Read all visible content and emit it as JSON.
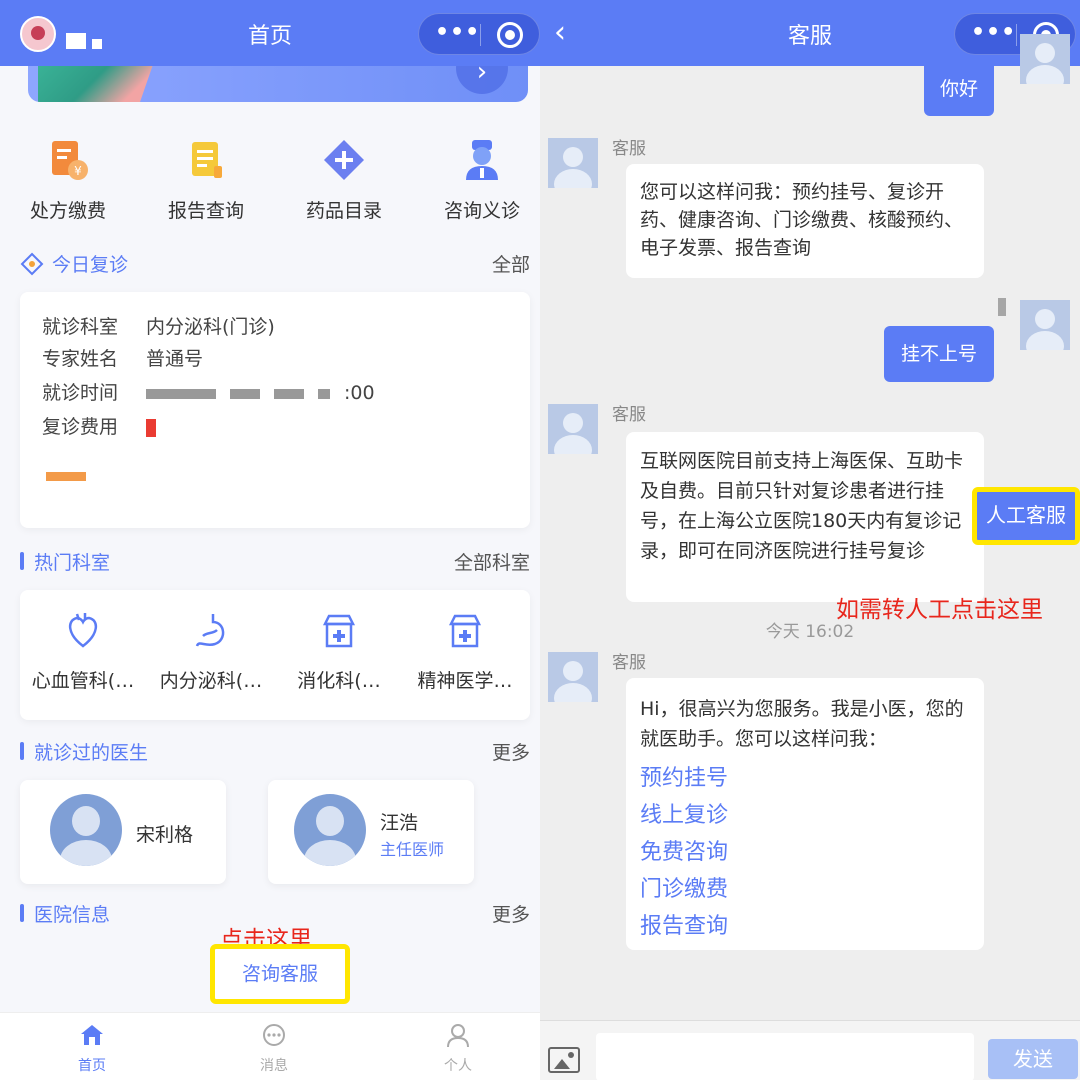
{
  "left": {
    "title": "首页",
    "quick_actions": [
      {
        "label": "处方缴费",
        "icon": "receipt-icon"
      },
      {
        "label": "报告查询",
        "icon": "report-icon"
      },
      {
        "label": "药品目录",
        "icon": "medicine-icon"
      },
      {
        "label": "咨询义诊",
        "icon": "doctor-icon"
      }
    ],
    "today_followup": {
      "title": "今日复诊",
      "more": "全部",
      "fields": [
        {
          "key": "就诊科室",
          "value": "内分泌科(门诊)"
        },
        {
          "key": "专家姓名",
          "value": "普通号"
        },
        {
          "key": "就诊时间",
          "value": ":00"
        },
        {
          "key": "复诊费用",
          "value": ""
        }
      ]
    },
    "hot_depts": {
      "title": "热门科室",
      "more": "全部科室",
      "items": [
        {
          "label": "心血管科(…",
          "icon": "heart-icon"
        },
        {
          "label": "内分泌科(…",
          "icon": "stomach-icon"
        },
        {
          "label": "消化科(…",
          "icon": "clinic-icon"
        },
        {
          "label": "精神医学…",
          "icon": "clinic-icon"
        }
      ]
    },
    "visited_doctors": {
      "title": "就诊过的医生",
      "more": "更多",
      "items": [
        {
          "name": "宋利格",
          "role": ""
        },
        {
          "name": "汪浩",
          "role": "主任医师"
        }
      ]
    },
    "hospital_info": {
      "title": "医院信息",
      "more": "更多"
    },
    "consult_button": "咨询客服",
    "annotation": "点击这里",
    "tabs": [
      {
        "label": "首页",
        "icon": "home-icon",
        "active": true
      },
      {
        "label": "消息",
        "icon": "message-icon",
        "active": false
      },
      {
        "label": "个人",
        "icon": "person-icon",
        "active": false
      }
    ]
  },
  "right": {
    "title": "客服",
    "messages": [
      {
        "from": "me",
        "text": "你好"
      },
      {
        "from": "bot",
        "sender": "客服",
        "text": "您可以这样问我：预约挂号、复诊开药、健康咨询、门诊缴费、核酸预约、电子发票、报告查询"
      },
      {
        "from": "me",
        "text": "挂不上号"
      },
      {
        "from": "bot",
        "sender": "客服",
        "text": "互联网医院目前支持上海医保、互助卡及自费。目前只针对复诊患者进行挂号，在上海公立医院180天内有复诊记录，即可在同济医院进行挂号复诊"
      },
      {
        "from": "bot",
        "sender": "客服",
        "text": "Hi，很高兴为您服务。我是小医，您的就医助手。您可以这样问我：",
        "links": [
          "预约挂号",
          "线上复诊",
          "免费咨询",
          "门诊缴费",
          "报告查询"
        ]
      }
    ],
    "timestamp": "今天 16:02",
    "human_service_button": "人工客服",
    "annotation": "如需转人工点击这里",
    "send_button": "发送"
  },
  "colors": {
    "primary": "#5b7cf5",
    "highlight": "#ffe600",
    "annotation": "#e8261c"
  }
}
